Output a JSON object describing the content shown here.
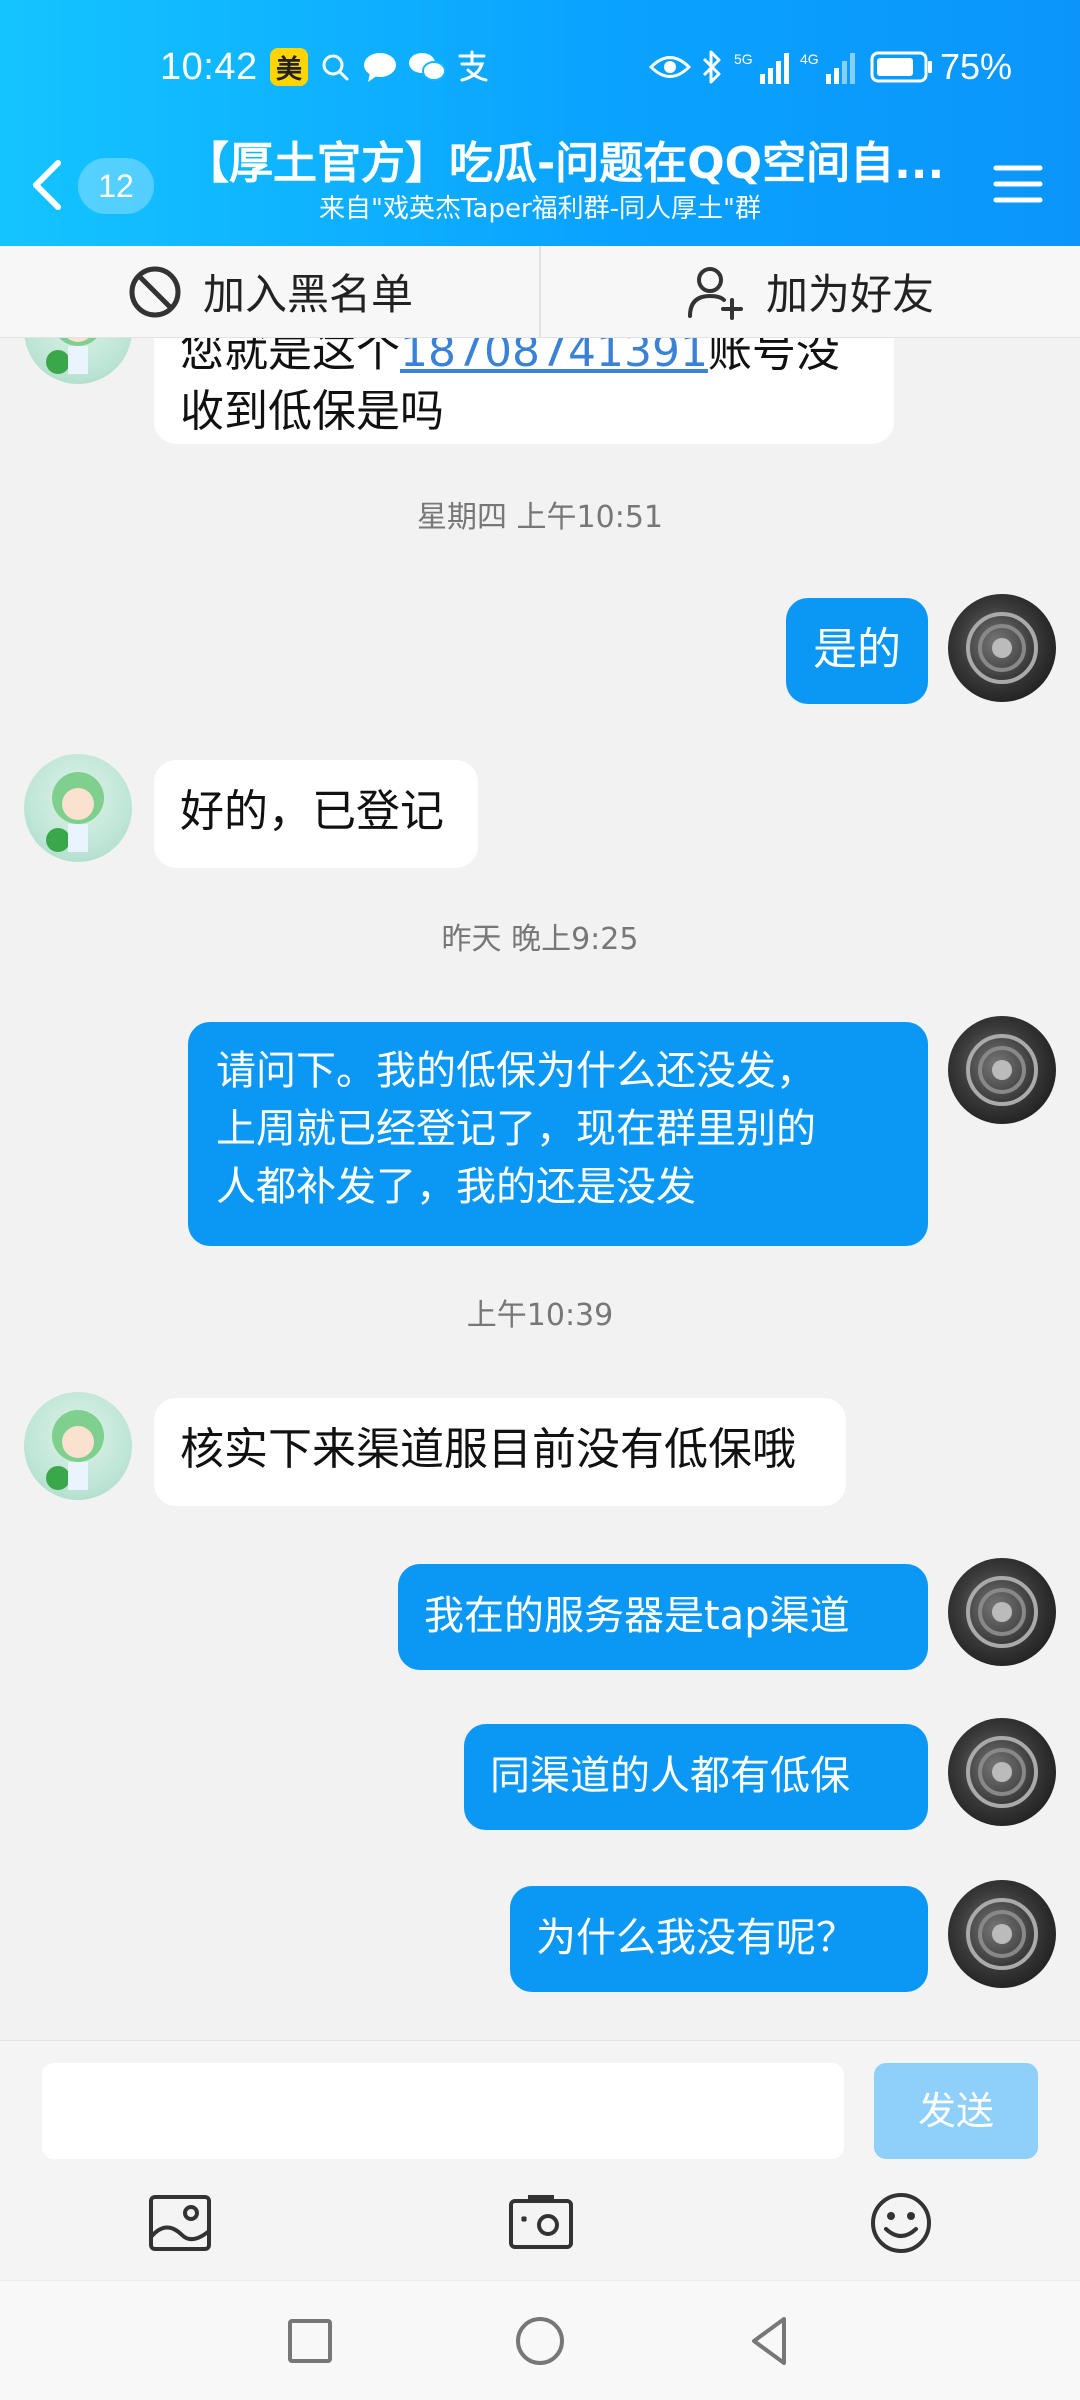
{
  "status_bar": {
    "time": "10:42",
    "app_badge": "美",
    "battery_percent": "75%",
    "network_1": "5G",
    "network_2": "4G"
  },
  "header": {
    "back_count": "12",
    "title": "【厚土官方】吃瓜-问题在QQ空间自...",
    "subtitle": "来自\"戏英杰Taper福利群-同人厚土\"群"
  },
  "action_bar": {
    "blacklist_label": "加入黑名单",
    "add_friend_label": "加为好友"
  },
  "messages": {
    "m0_line1_pre": "您就是这个",
    "m0_line1_link": "18708741391",
    "m0_line1_post": "账号没",
    "m0_line2": "收到低保是吗",
    "ts1": "星期四 上午10:51",
    "m1": "是的",
    "m2": "好的，已登记",
    "ts2": "昨天 晚上9:25",
    "m3_line1": "请问下。我的低保为什么还没发，",
    "m3_line2": "上周就已经登记了，现在群里别的",
    "m3_line3": "人都补发了，我的还是没发",
    "ts3": "上午10:39",
    "m4": "核实下来渠道服目前没有低保哦",
    "m5": "我在的服务器是tap渠道",
    "m6": "同渠道的人都有低保",
    "m7": "为什么我没有呢？"
  },
  "input": {
    "value": "",
    "send_label": "发送"
  },
  "colors": {
    "header_start": "#14c4ff",
    "header_end": "#0b95fb",
    "outgoing_bubble": "#0b98f5",
    "incoming_bubble": "#ffffff",
    "send_disabled": "#8fd0fb",
    "link": "#3b82d6"
  },
  "icons": {
    "back": "chevron-left-icon",
    "menu": "hamburger-menu-icon",
    "blacklist": "block-icon",
    "add_friend": "add-person-icon",
    "image": "image-icon",
    "camera": "camera-icon",
    "emoji": "emoji-icon"
  }
}
